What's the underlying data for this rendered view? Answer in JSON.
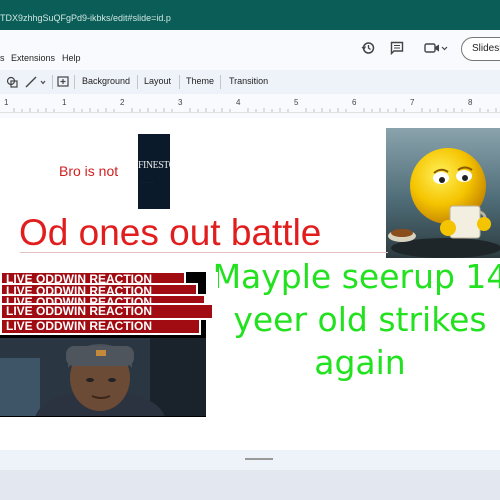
{
  "browser": {
    "url_fragment": "TDX9zhhgSuQFgPd9-ikbks/edit#slide=id.p"
  },
  "menu": {
    "items": [
      "s",
      "Extensions",
      "Help"
    ],
    "slideshow_label": "Slidesh"
  },
  "toolbar": {
    "background_label": "Background",
    "layout_label": "Layout",
    "theme_label": "Theme",
    "transition_label": "Transition"
  },
  "ruler": {
    "numbers": [
      "1",
      "1",
      "2",
      "3",
      "4",
      "5",
      "6",
      "7",
      "8"
    ]
  },
  "slide": {
    "bro_text": "Bro is not",
    "finesto_text": "FINESTO",
    "title": "Od ones out battle",
    "green_text": "Mayple seerup 14 yeer old strikes again",
    "banners": [
      "LIVE ODDWIN REACTION",
      "LIVE ODDWIN REACTION",
      "LIVE ODDWIN REACTION",
      "LIVE ODDWIN REACTION",
      "LIVE ODDWIN REACTION"
    ]
  },
  "colors": {
    "red_text": "#e11d1d",
    "green_text": "#22e21f",
    "banner_red": "#a10c12",
    "address_bar": "#0b5d57"
  }
}
